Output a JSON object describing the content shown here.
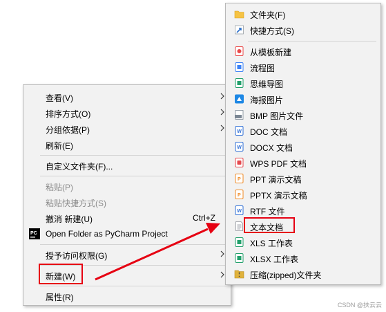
{
  "main_menu": {
    "items": [
      {
        "label": "查看(V)",
        "submenu": true
      },
      {
        "label": "排序方式(O)",
        "submenu": true
      },
      {
        "label": "分组依据(P)",
        "submenu": true
      },
      {
        "label": "刷新(E)"
      },
      {
        "label": "自定义文件夹(F)..."
      },
      {
        "label": "粘贴(P)",
        "disabled": true
      },
      {
        "label": "粘贴快捷方式(S)",
        "disabled": true
      },
      {
        "label": "撤消 新建(U)",
        "shortcut": "Ctrl+Z"
      },
      {
        "label": "Open Folder as PyCharm Project",
        "icon": "pycharm-icon"
      },
      {
        "label": "授予访问权限(G)",
        "submenu": true
      },
      {
        "label": "新建(W)",
        "submenu": true,
        "highlighted": true
      },
      {
        "label": "属性(R)"
      }
    ]
  },
  "sub_menu": {
    "items": [
      {
        "label": "文件夹(F)",
        "icon": "folder-icon",
        "color": "#f6c343"
      },
      {
        "label": "快捷方式(S)",
        "icon": "shortcut-icon",
        "color": "#2b6fc9"
      },
      {
        "label": "从模板新建",
        "icon": "template-icon",
        "color": "#e94848"
      },
      {
        "label": "流程图",
        "icon": "flowchart-icon",
        "color": "#3b82f6"
      },
      {
        "label": "思维导图",
        "icon": "mindmap-icon",
        "color": "#22a06b"
      },
      {
        "label": "海报图片",
        "icon": "poster-icon",
        "color": "#1e88e5"
      },
      {
        "label": "BMP 图片文件",
        "icon": "bmp-icon",
        "color": "#7b8794"
      },
      {
        "label": "DOC 文档",
        "icon": "doc-icon",
        "color": "#2f6fd6"
      },
      {
        "label": "DOCX 文档",
        "icon": "docx-icon",
        "color": "#2f6fd6"
      },
      {
        "label": "WPS PDF 文档",
        "icon": "pdf-icon",
        "color": "#e5484d"
      },
      {
        "label": "PPT 演示文稿",
        "icon": "ppt-icon",
        "color": "#f08a24"
      },
      {
        "label": "PPTX 演示文稿",
        "icon": "pptx-icon",
        "color": "#f08a24"
      },
      {
        "label": "RTF 文件",
        "icon": "rtf-icon",
        "color": "#2f6fd6"
      },
      {
        "label": "文本文档",
        "icon": "text-document-icon",
        "color": "#9aa0a6",
        "highlighted": true
      },
      {
        "label": "XLS 工作表",
        "icon": "xls-icon",
        "color": "#22a06b"
      },
      {
        "label": "XLSX 工作表",
        "icon": "xlsx-icon",
        "color": "#22a06b"
      },
      {
        "label": "压缩(zipped)文件夹",
        "icon": "zip-folder-icon",
        "color": "#e0b23c"
      }
    ]
  },
  "annotation_color": "#e60012",
  "watermark": "CSDN @扶云云"
}
